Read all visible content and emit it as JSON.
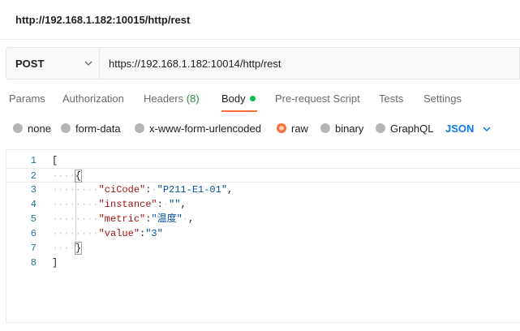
{
  "window": {
    "title": "http://192.168.1.182:10015/http/rest"
  },
  "request": {
    "method": "POST",
    "url": "https://192.168.1.182:10014/http/rest"
  },
  "tabs": [
    {
      "label": "Params"
    },
    {
      "label": "Authorization"
    },
    {
      "label": "Headers",
      "count": "(8)"
    },
    {
      "label": "Body"
    },
    {
      "label": "Pre-request Script"
    },
    {
      "label": "Tests"
    },
    {
      "label": "Settings"
    }
  ],
  "body_types": [
    {
      "label": "none"
    },
    {
      "label": "form-data"
    },
    {
      "label": "x-www-form-urlencoded"
    },
    {
      "label": "raw"
    },
    {
      "label": "binary"
    },
    {
      "label": "GraphQL"
    }
  ],
  "selected_body_type": "raw",
  "language": "JSON",
  "editor": {
    "line_numbers": [
      "1",
      "2",
      "3",
      "4",
      "5",
      "6",
      "7",
      "8"
    ],
    "lines": [
      "[",
      "{",
      "\"ciCode\": \"P211-E1-01\",",
      "\"instance\": \"\",",
      "\"metric\":\"温度\" ,",
      "\"value\":\"3\"",
      "}",
      "]"
    ],
    "tokens": {
      "open_bracket": "[",
      "open_brace": "{",
      "ciCode_key": "\"ciCode\"",
      "ciCode_value": "\"P211-E1-01\"",
      "instance_key": "\"instance\"",
      "instance_value": "\"\"",
      "metric_key": "\"metric\"",
      "metric_value": "\"温度\"",
      "value_key": "\"value\"",
      "value_value": "\"3\"",
      "close_brace": "}",
      "close_bracket": "]"
    }
  },
  "colors": {
    "accent": "#ff6c37",
    "active_dot": "#0cbb52",
    "link_blue": "#097bed"
  }
}
